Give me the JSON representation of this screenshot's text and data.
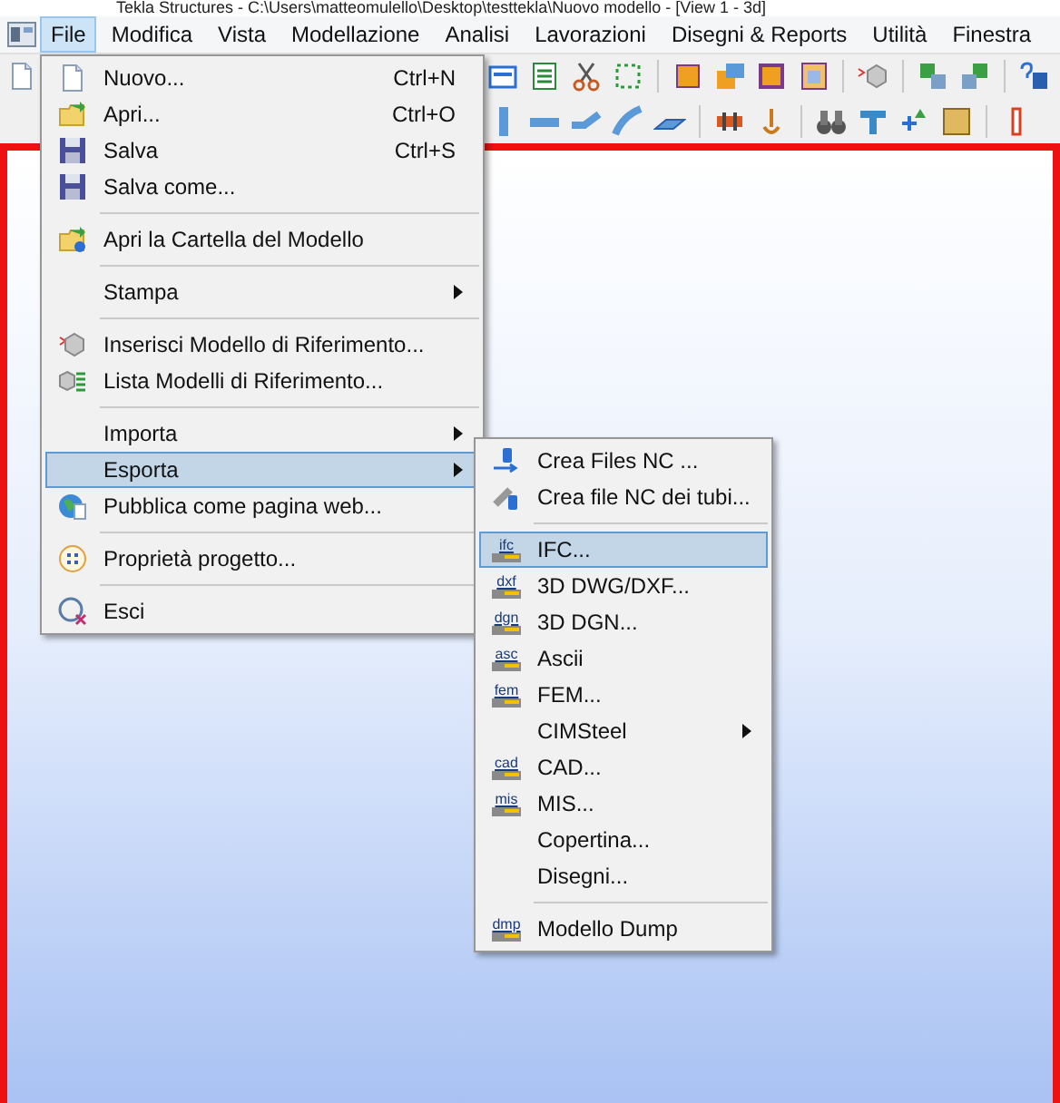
{
  "window": {
    "title": "Tekla Structures - C:\\Users\\matteomulello\\Desktop\\testtekla\\Nuovo modello - [View 1 - 3d]"
  },
  "menubar": [
    {
      "label": "File",
      "selected": true
    },
    {
      "label": "Modifica",
      "selected": false
    },
    {
      "label": "Vista",
      "selected": false
    },
    {
      "label": "Modellazione",
      "selected": false
    },
    {
      "label": "Analisi",
      "selected": false
    },
    {
      "label": "Lavorazioni",
      "selected": false
    },
    {
      "label": "Disegni & Reports",
      "selected": false
    },
    {
      "label": "Utilità",
      "selected": false
    },
    {
      "label": "Finestra",
      "selected": false
    }
  ],
  "file_menu": [
    {
      "kind": "item",
      "label": "Nuovo...",
      "shortcut": "Ctrl+N",
      "selected": false
    },
    {
      "kind": "item",
      "label": "Apri...",
      "shortcut": "Ctrl+O",
      "selected": false
    },
    {
      "kind": "item",
      "label": "Salva",
      "shortcut": "Ctrl+S",
      "selected": false
    },
    {
      "kind": "item",
      "label": "Salva come...",
      "selected": false
    },
    {
      "kind": "separator"
    },
    {
      "kind": "item",
      "label": "Apri la Cartella del Modello",
      "selected": false
    },
    {
      "kind": "separator"
    },
    {
      "kind": "submenu",
      "label": "Stampa",
      "selected": false
    },
    {
      "kind": "separator"
    },
    {
      "kind": "item",
      "label": "Inserisci Modello di Riferimento...",
      "selected": false
    },
    {
      "kind": "item",
      "label": "Lista Modelli di Riferimento...",
      "selected": false
    },
    {
      "kind": "separator"
    },
    {
      "kind": "submenu",
      "label": "Importa",
      "selected": false
    },
    {
      "kind": "submenu",
      "label": "Esporta",
      "selected": true
    },
    {
      "kind": "item",
      "label": "Pubblica come pagina web...",
      "selected": false
    },
    {
      "kind": "separator"
    },
    {
      "kind": "item",
      "label": "Proprietà progetto...",
      "selected": false
    },
    {
      "kind": "separator"
    },
    {
      "kind": "item",
      "label": "Esci",
      "selected": false
    }
  ],
  "export_submenu": [
    {
      "kind": "item",
      "label": "Crea Files NC ...",
      "selected": false
    },
    {
      "kind": "item",
      "label": "Crea file NC dei tubi...",
      "selected": false
    },
    {
      "kind": "separator"
    },
    {
      "kind": "item",
      "label": "IFC...",
      "icon_label": "ifc",
      "selected": true
    },
    {
      "kind": "item",
      "label": "3D DWG/DXF...",
      "icon_label": "dxf",
      "selected": false
    },
    {
      "kind": "item",
      "label": "3D DGN...",
      "icon_label": "dgn",
      "selected": false
    },
    {
      "kind": "item",
      "label": "Ascii",
      "icon_label": "asc",
      "selected": false
    },
    {
      "kind": "item",
      "label": "FEM...",
      "icon_label": "fem",
      "selected": false
    },
    {
      "kind": "submenu",
      "label": "CIMSteel",
      "selected": false
    },
    {
      "kind": "item",
      "label": "CAD...",
      "icon_label": "cad",
      "selected": false
    },
    {
      "kind": "item",
      "label": "MIS...",
      "icon_label": "mis",
      "selected": false
    },
    {
      "kind": "item",
      "label": "Copertina...",
      "selected": false
    },
    {
      "kind": "item",
      "label": "Disegni...",
      "selected": false
    },
    {
      "kind": "separator"
    },
    {
      "kind": "item",
      "label": "Modello Dump",
      "icon_label": "dmp",
      "selected": false
    }
  ]
}
